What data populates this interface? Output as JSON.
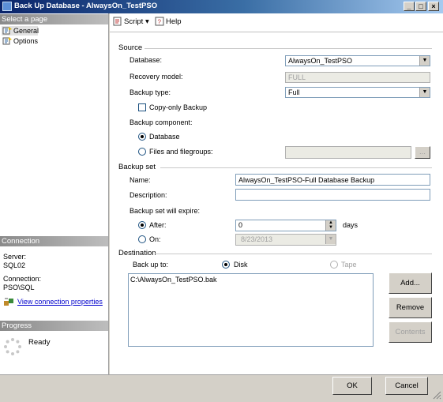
{
  "window": {
    "title": "Back Up Database - AlwaysOn_TestPSO",
    "controls": [
      "_",
      "□",
      "×"
    ]
  },
  "sidebar": {
    "select_page_header": "Select a page",
    "items": [
      {
        "label": "General",
        "selected": true
      },
      {
        "label": "Options",
        "selected": false
      }
    ],
    "connection_header": "Connection",
    "server_label": "Server:",
    "server_value": "SQL02",
    "connection_label": "Connection:",
    "connection_value": "PSO\\SQL",
    "view_props_link": "View connection properties",
    "progress_header": "Progress",
    "progress_status": "Ready"
  },
  "toolbar": {
    "script_label": "Script",
    "help_label": "Help"
  },
  "source": {
    "group_label": "Source",
    "database_label": "Database:",
    "database_value": "AlwaysOn_TestPSO",
    "recovery_label": "Recovery model:",
    "recovery_value": "FULL",
    "backup_type_label": "Backup type:",
    "backup_type_value": "Full",
    "copy_only_label": "Copy-only Backup",
    "copy_only_checked": false,
    "component_label": "Backup component:",
    "component_database": "Database",
    "component_files": "Files and filegroups:",
    "files_button": "..."
  },
  "backup_set": {
    "group_label": "Backup set",
    "name_label": "Name:",
    "name_value": "AlwaysOn_TestPSO-Full Database Backup",
    "description_label": "Description:",
    "description_value": "",
    "expire_label": "Backup set will expire:",
    "after_label": "After:",
    "after_value": "0",
    "days_label": "days",
    "on_label": "On:",
    "on_value": "8/23/2013"
  },
  "destination": {
    "group_label": "Destination",
    "backup_to_label": "Back up to:",
    "disk_label": "Disk",
    "tape_label": "Tape",
    "paths": [
      "C:\\AlwaysOn_TestPSO.bak"
    ],
    "add_button": "Add...",
    "remove_button": "Remove",
    "contents_button": "Contents"
  },
  "footer": {
    "ok_button": "OK",
    "cancel_button": "Cancel"
  },
  "colors": {
    "title_start": "#0a246a",
    "title_end": "#a6caf0",
    "link": "#0000cc",
    "chrome": "#d4d0c8"
  }
}
